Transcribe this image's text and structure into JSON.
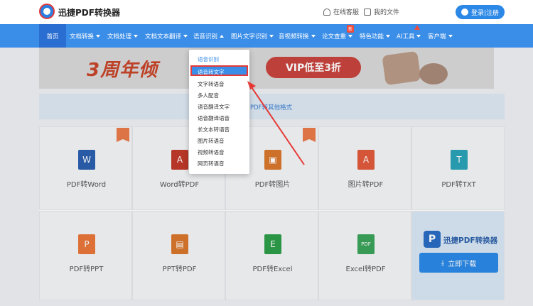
{
  "header": {
    "brand": "迅捷PDF转换器",
    "service": "在线客服",
    "files": "我的文件",
    "login": "登录|注册"
  },
  "nav": {
    "items": [
      {
        "label": "首页"
      },
      {
        "label": "文档转换"
      },
      {
        "label": "文档处理"
      },
      {
        "label": "文档文本翻译"
      },
      {
        "label": "语音识别"
      },
      {
        "label": "图片文字识别"
      },
      {
        "label": "音视频转换"
      },
      {
        "label": "论文查重"
      },
      {
        "label": "特色功能"
      },
      {
        "label": "AI工具"
      },
      {
        "label": "客户端"
      }
    ],
    "new_badge": "新"
  },
  "banner": {
    "title": "3周年倾",
    "pill": "VIP低至3折"
  },
  "info": {
    "text": "PDF转其他格式"
  },
  "dropdown": {
    "group_label": "语音识别",
    "items": [
      "语音转文字",
      "文字转语音",
      "多人配音",
      "语音翻译文字",
      "语音翻译语音",
      "长文本转语音",
      "图片转语音",
      "视频转语音",
      "网页转语音"
    ]
  },
  "grid": {
    "cells": [
      {
        "label": "PDF转Word",
        "icon": "W",
        "color": "#2b5fae"
      },
      {
        "label": "Word转PDF",
        "icon": "A",
        "color": "#c0392b"
      },
      {
        "label": "PDF转图片",
        "icon": "▣",
        "color": "#d8772d"
      },
      {
        "label": "图片转PDF",
        "icon": "A",
        "color": "#e05a3a"
      },
      {
        "label": "PDF转TXT",
        "icon": "T",
        "color": "#2aa3b8"
      },
      {
        "label": "PDF转PPT",
        "icon": "P",
        "color": "#e8773a"
      },
      {
        "label": "PPT转PDF",
        "icon": "▤",
        "color": "#d8772d"
      },
      {
        "label": "PDF转Excel",
        "icon": "E",
        "color": "#2e9e4a"
      },
      {
        "label": "Excel转PDF",
        "icon": "PDF",
        "color": "#3aa35a"
      }
    ],
    "promo": {
      "name": "迅捷PDF转换器",
      "button": "立即下载"
    }
  }
}
